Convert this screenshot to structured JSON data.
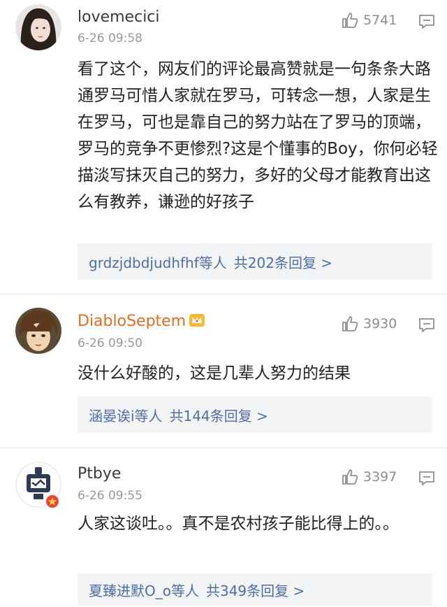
{
  "comments": [
    {
      "username": "lovemecici",
      "time": "6-26 09:58",
      "likes": "5741",
      "text": "看了这个，网友们的评论最高赞就是一句条条大路通罗马可惜人家就在罗马，可转念一想，人家是生在罗马，可也是靠自己的努力站在了罗马的顶端，罗马的竞争不更惨烈?这是个懂事的Boy，你何必轻描淡写抹灭自己的努力，多好的父母才能教育出这么有教养，谦逊的好孩子",
      "replies_users": "grdzjdbdjudhfhf等人",
      "replies_count": "共202条回复 >"
    },
    {
      "username": "DiabloSeptem",
      "time": "6-26 09:50",
      "likes": "3930",
      "text": "没什么好酸的，这是几辈人努力的结果",
      "replies_users": "涵晏诶i等人",
      "replies_count": "共144条回复 >"
    },
    {
      "username": "Ptbye",
      "time": "6-26 09:55",
      "likes": "3397",
      "text": "人家这谈吐。。真不是农村孩子能比得上的。。",
      "replies_users": "夏臻进默O_o等人",
      "replies_count": "共349条回复 >"
    }
  ],
  "colors": {
    "link": "#4d6fa3",
    "vip_name": "#e66b1c",
    "reply_bg": "#f2f3f5",
    "meta": "#9a9a9a"
  },
  "icons": [
    "thumbs-up-icon",
    "comment-bubble-icon",
    "crown-badge-icon",
    "verified-badge-icon"
  ]
}
